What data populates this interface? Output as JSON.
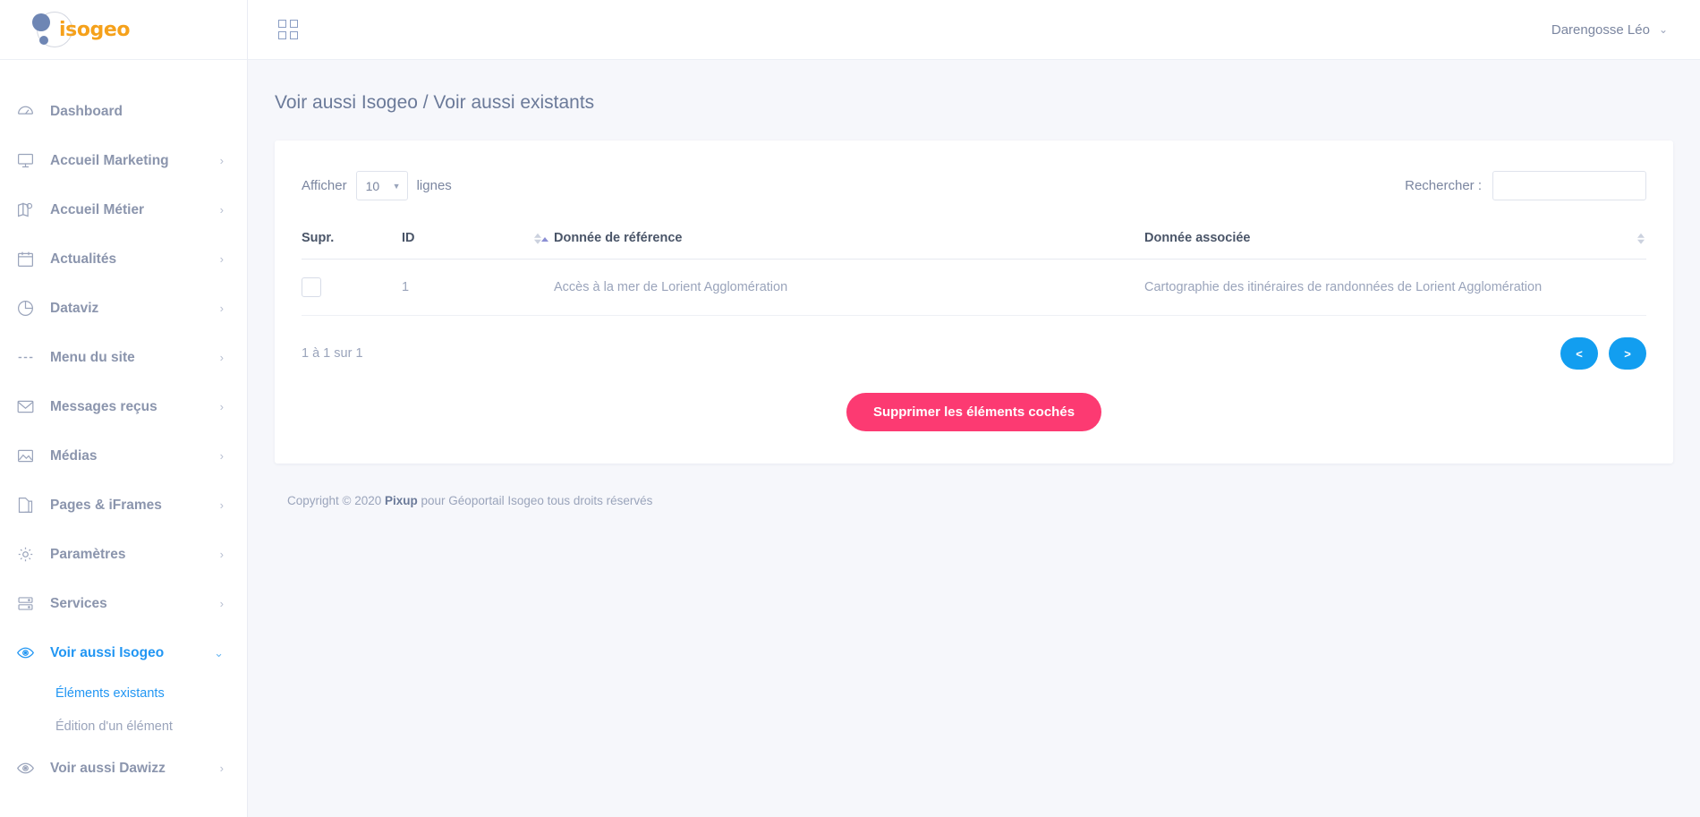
{
  "brand": {
    "name": "isogeo"
  },
  "topbar": {
    "grid_icon": "grid-icon",
    "user_name": "Darengosse Léo",
    "user_chevron": "⌄"
  },
  "sidebar": {
    "items": [
      {
        "label": "Dashboard",
        "icon": "dashboard-icon",
        "has_chevron": false,
        "active": false
      },
      {
        "label": "Accueil Marketing",
        "icon": "screen-icon",
        "has_chevron": true,
        "active": false
      },
      {
        "label": "Accueil Métier",
        "icon": "map-icon",
        "has_chevron": true,
        "active": false
      },
      {
        "label": "Actualités",
        "icon": "calendar-icon",
        "has_chevron": true,
        "active": false
      },
      {
        "label": "Dataviz",
        "icon": "pie-chart-icon",
        "has_chevron": true,
        "active": false
      },
      {
        "label": "Menu du site",
        "icon": "menu-icon",
        "has_chevron": true,
        "active": false
      },
      {
        "label": "Messages reçus",
        "icon": "envelope-icon",
        "has_chevron": true,
        "active": false
      },
      {
        "label": "Médias",
        "icon": "image-icon",
        "has_chevron": true,
        "active": false
      },
      {
        "label": "Pages & iFrames",
        "icon": "pages-icon",
        "has_chevron": true,
        "active": false
      },
      {
        "label": "Paramètres",
        "icon": "gear-icon",
        "has_chevron": true,
        "active": false
      },
      {
        "label": "Services",
        "icon": "server-icon",
        "has_chevron": true,
        "active": false
      },
      {
        "label": "Voir aussi Isogeo",
        "icon": "eye-icon",
        "has_chevron": true,
        "active": true
      },
      {
        "label": "Voir aussi Dawizz",
        "icon": "eye-icon",
        "has_chevron": true,
        "active": false
      }
    ],
    "submenu": [
      {
        "label": "Éléments existants",
        "active": true
      },
      {
        "label": "Édition d'un élément",
        "active": false
      }
    ]
  },
  "page": {
    "title": "Voir aussi Isogeo / Voir aussi existants"
  },
  "table_controls": {
    "length_prefix": "Afficher",
    "length_value": "10",
    "length_suffix": "lignes",
    "search_label": "Rechercher :",
    "search_value": "",
    "search_placeholder": ""
  },
  "table": {
    "columns": [
      {
        "label": "Supr.",
        "sortable": false,
        "sort": "none"
      },
      {
        "label": "ID",
        "sortable": true,
        "sort": "none"
      },
      {
        "label": "Donnée de référence",
        "sortable": true,
        "sort": "asc"
      },
      {
        "label": "Donnée associée",
        "sortable": true,
        "sort": "none"
      }
    ],
    "rows": [
      {
        "checked": false,
        "id": "1",
        "reference": "Accès à la mer de Lorient Agglomération",
        "associated": "Cartographie des itinéraires de randonnées de Lorient Agglomération"
      }
    ],
    "info": "1 à 1 sur 1",
    "pager": {
      "prev": "<",
      "next": ">"
    }
  },
  "actions": {
    "delete_label": "Supprimer les éléments cochés"
  },
  "footer": {
    "copyright_pre": "Copyright © 2020 ",
    "copyright_brand": "Pixup",
    "copyright_post": " pour Géoportail Isogeo tous droits réservés"
  },
  "colors": {
    "accent_blue": "#2196f3",
    "pager_blue": "#129ef0",
    "delete_pink": "#fc3a72",
    "logo_orange": "#f5a11b",
    "logo_blue": "#6e86b4",
    "sort_active": "#8b8fd4"
  }
}
